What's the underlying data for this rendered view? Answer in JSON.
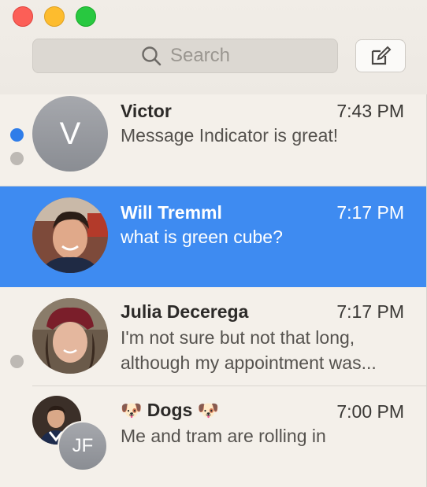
{
  "search": {
    "placeholder": "Search",
    "icon": "search-icon"
  },
  "compose": {
    "icon": "compose-icon"
  },
  "conversations": [
    {
      "name": "Victor",
      "time": "7:43 PM",
      "preview": "Message Indicator is great!",
      "initials": "V",
      "unread": true
    },
    {
      "name": "Will Tremml",
      "time": "7:17 PM",
      "preview": "what is green cube?",
      "selected": true
    },
    {
      "name": "Julia Decerega",
      "time": "7:17 PM",
      "preview_line1": "I'm not sure but not that long,",
      "preview_line2": "although my appointment was..."
    },
    {
      "name_emoji_left": "🐶",
      "name": "Dogs",
      "name_emoji_right": "🐶",
      "time": "7:00 PM",
      "preview": "Me and tram are rolling in",
      "initials": "JF"
    }
  ],
  "colors": {
    "selected": "#3e8bf1",
    "unread_dot": "#2f7de9",
    "background": "#f4f0ea"
  }
}
